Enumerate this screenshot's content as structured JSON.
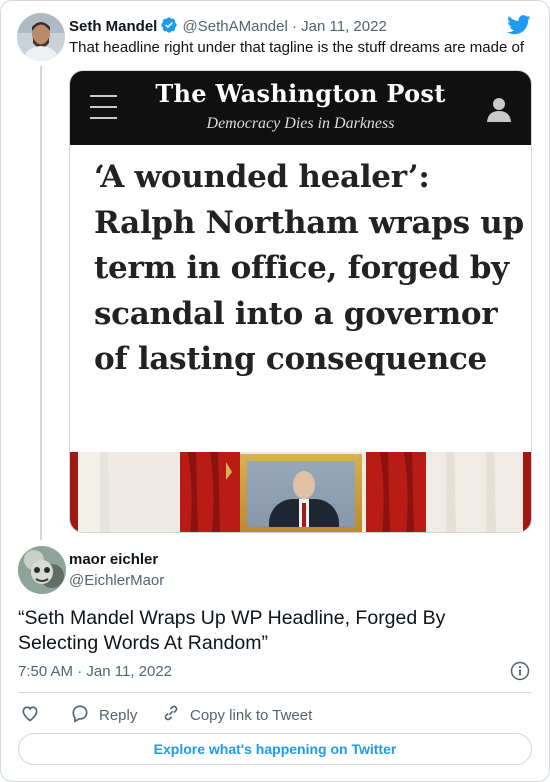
{
  "colors": {
    "accent": "#1d9bf0",
    "text_primary": "#0f1419",
    "text_secondary": "#536471",
    "border": "#cfd9de",
    "wp_bar": "#101010"
  },
  "quoted_tweet": {
    "author_name": "Seth Mandel",
    "verified_icon": "verified-badge-icon",
    "handle": "@SethAMandel",
    "separator": "·",
    "date": "Jan 11, 2022",
    "text": "That headline right under that tagline is the stuff dreams are made of",
    "media": {
      "masthead": "The Washington Post",
      "tagline": "Democracy Dies in Darkness",
      "headline": "‘A wounded healer’: Ralph Northam wraps up term in office, forged by scandal into a governor of lasting consequence"
    }
  },
  "tweet": {
    "author_name": "maor eichler",
    "handle": "@EichlerMaor",
    "text": "“Seth Mandel Wraps Up WP Headline, Forged By Selecting Words At Random”",
    "time": "7:50 AM",
    "separator": "·",
    "date": "Jan 11, 2022"
  },
  "actions": {
    "reply_label": "Reply",
    "copy_link_label": "Copy link to Tweet"
  },
  "explore_label": "Explore what's happening on Twitter"
}
